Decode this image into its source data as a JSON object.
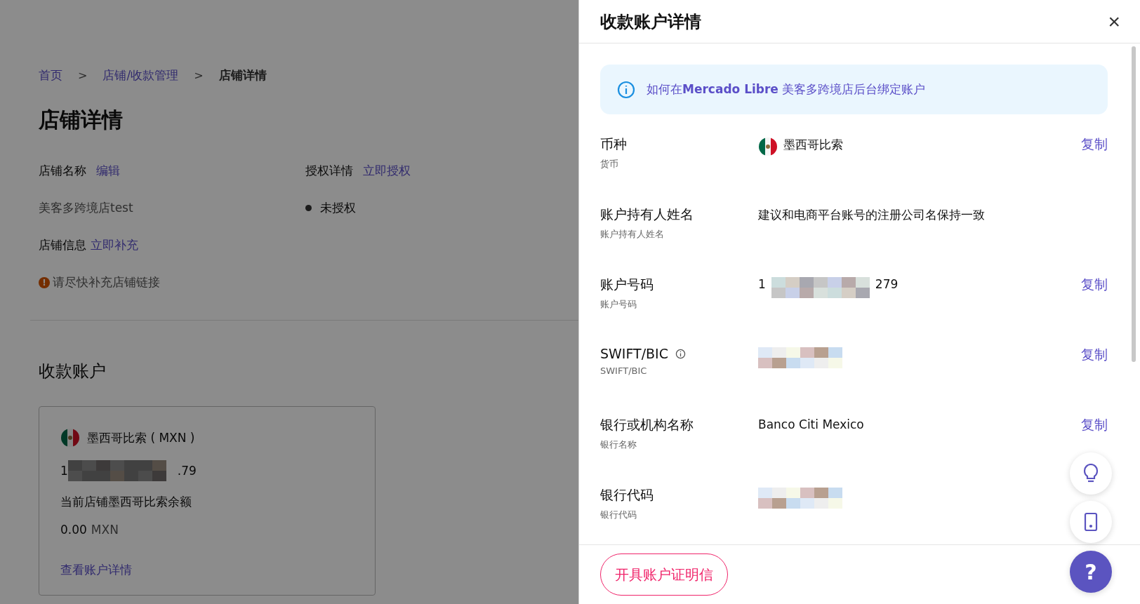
{
  "breadcrumb": [
    {
      "label": "首页",
      "current": false
    },
    {
      "label": "店铺/收款管理",
      "current": false
    },
    {
      "label": "店铺详情",
      "current": true
    }
  ],
  "breadcrumb_separator": ">",
  "page_title": "店铺详情",
  "store_fields": [
    {
      "label": "店铺名称",
      "action": "编辑",
      "value": "美客多跨境店test"
    },
    {
      "label": "授权详情",
      "action": "立即授权",
      "value": "未授权",
      "status_dot": true
    }
  ],
  "store_info": {
    "label": "店铺信息",
    "action": "立即补充",
    "warning_icon": "!",
    "warning": "请尽快补充店铺链接"
  },
  "section_title": "收款账户",
  "account_card": {
    "currency": "墨西哥比索 ( MXN )",
    "number_prefix": "1",
    "number_suffix": ".79",
    "balance_label": "当前店铺墨西哥比索余额",
    "balance": "0.00",
    "balance_unit": "MXN",
    "link": "查看账户详情"
  },
  "drawer": {
    "title": "收款账户详情",
    "close": "×",
    "notice": "如何在**Mercado Libre** 美客多跨境店后台绑定账户",
    "rows": [
      {
        "label": "币种",
        "sublabel": "货币",
        "kind": "flag",
        "value": "墨西哥比索",
        "copy": "复制"
      },
      {
        "label": "账户持有人姓名",
        "sublabel": "账户持有人姓名",
        "kind": "text",
        "value": "建议和电商平台账号的注册公司名保持一致"
      },
      {
        "label": "账户号码",
        "sublabel": "账户号码",
        "kind": "masked",
        "prefix": "1",
        "suffix": "279",
        "copy": "复制"
      },
      {
        "label": "SWIFT/BIC",
        "sublabel": "SWIFT/BIC",
        "kind": "masked",
        "info": true,
        "copy": "复制"
      },
      {
        "label": "银行或机构名称",
        "sublabel": "银行名称",
        "kind": "text",
        "value": "Banco Citi Mexico",
        "copy": "复制"
      },
      {
        "label": "银行代码",
        "sublabel": "银行代码",
        "kind": "masked"
      }
    ],
    "footer_button": "开具账户证明信"
  },
  "help_button": "?"
}
